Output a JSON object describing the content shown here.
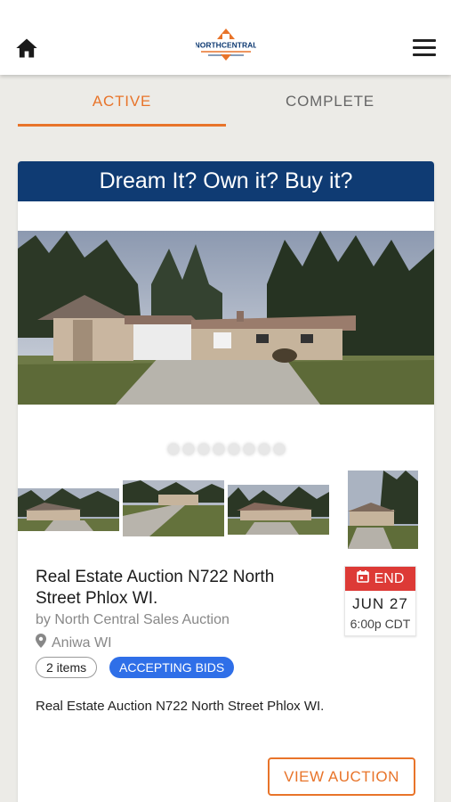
{
  "header": {
    "home_icon": "home-icon",
    "logo_text": "NORTHCENTRAL",
    "menu_icon": "hamburger-menu-icon"
  },
  "tabs": [
    {
      "label": "ACTIVE",
      "active": true
    },
    {
      "label": "COMPLETE",
      "active": false
    }
  ],
  "auction": {
    "banner": "Dream It? Own it? Buy it?",
    "carousel_dot_count": 8,
    "title": "Real Estate Auction N722 North Street Phlox WI.",
    "seller": "by North Central Sales Auction",
    "location": "Aniwa WI",
    "items_count": "2 items",
    "status": "ACCEPTING BIDS",
    "description": "Real Estate Auction N722 North Street Phlox WI.",
    "end": {
      "label": "END",
      "date": "JUN 27",
      "time": "6:00p CDT"
    },
    "view_button": "VIEW AUCTION"
  },
  "colors": {
    "accent": "#e8742a",
    "banner": "#0f3b73",
    "status_pill": "#2f6fe8",
    "end_red": "#dd3a36"
  }
}
